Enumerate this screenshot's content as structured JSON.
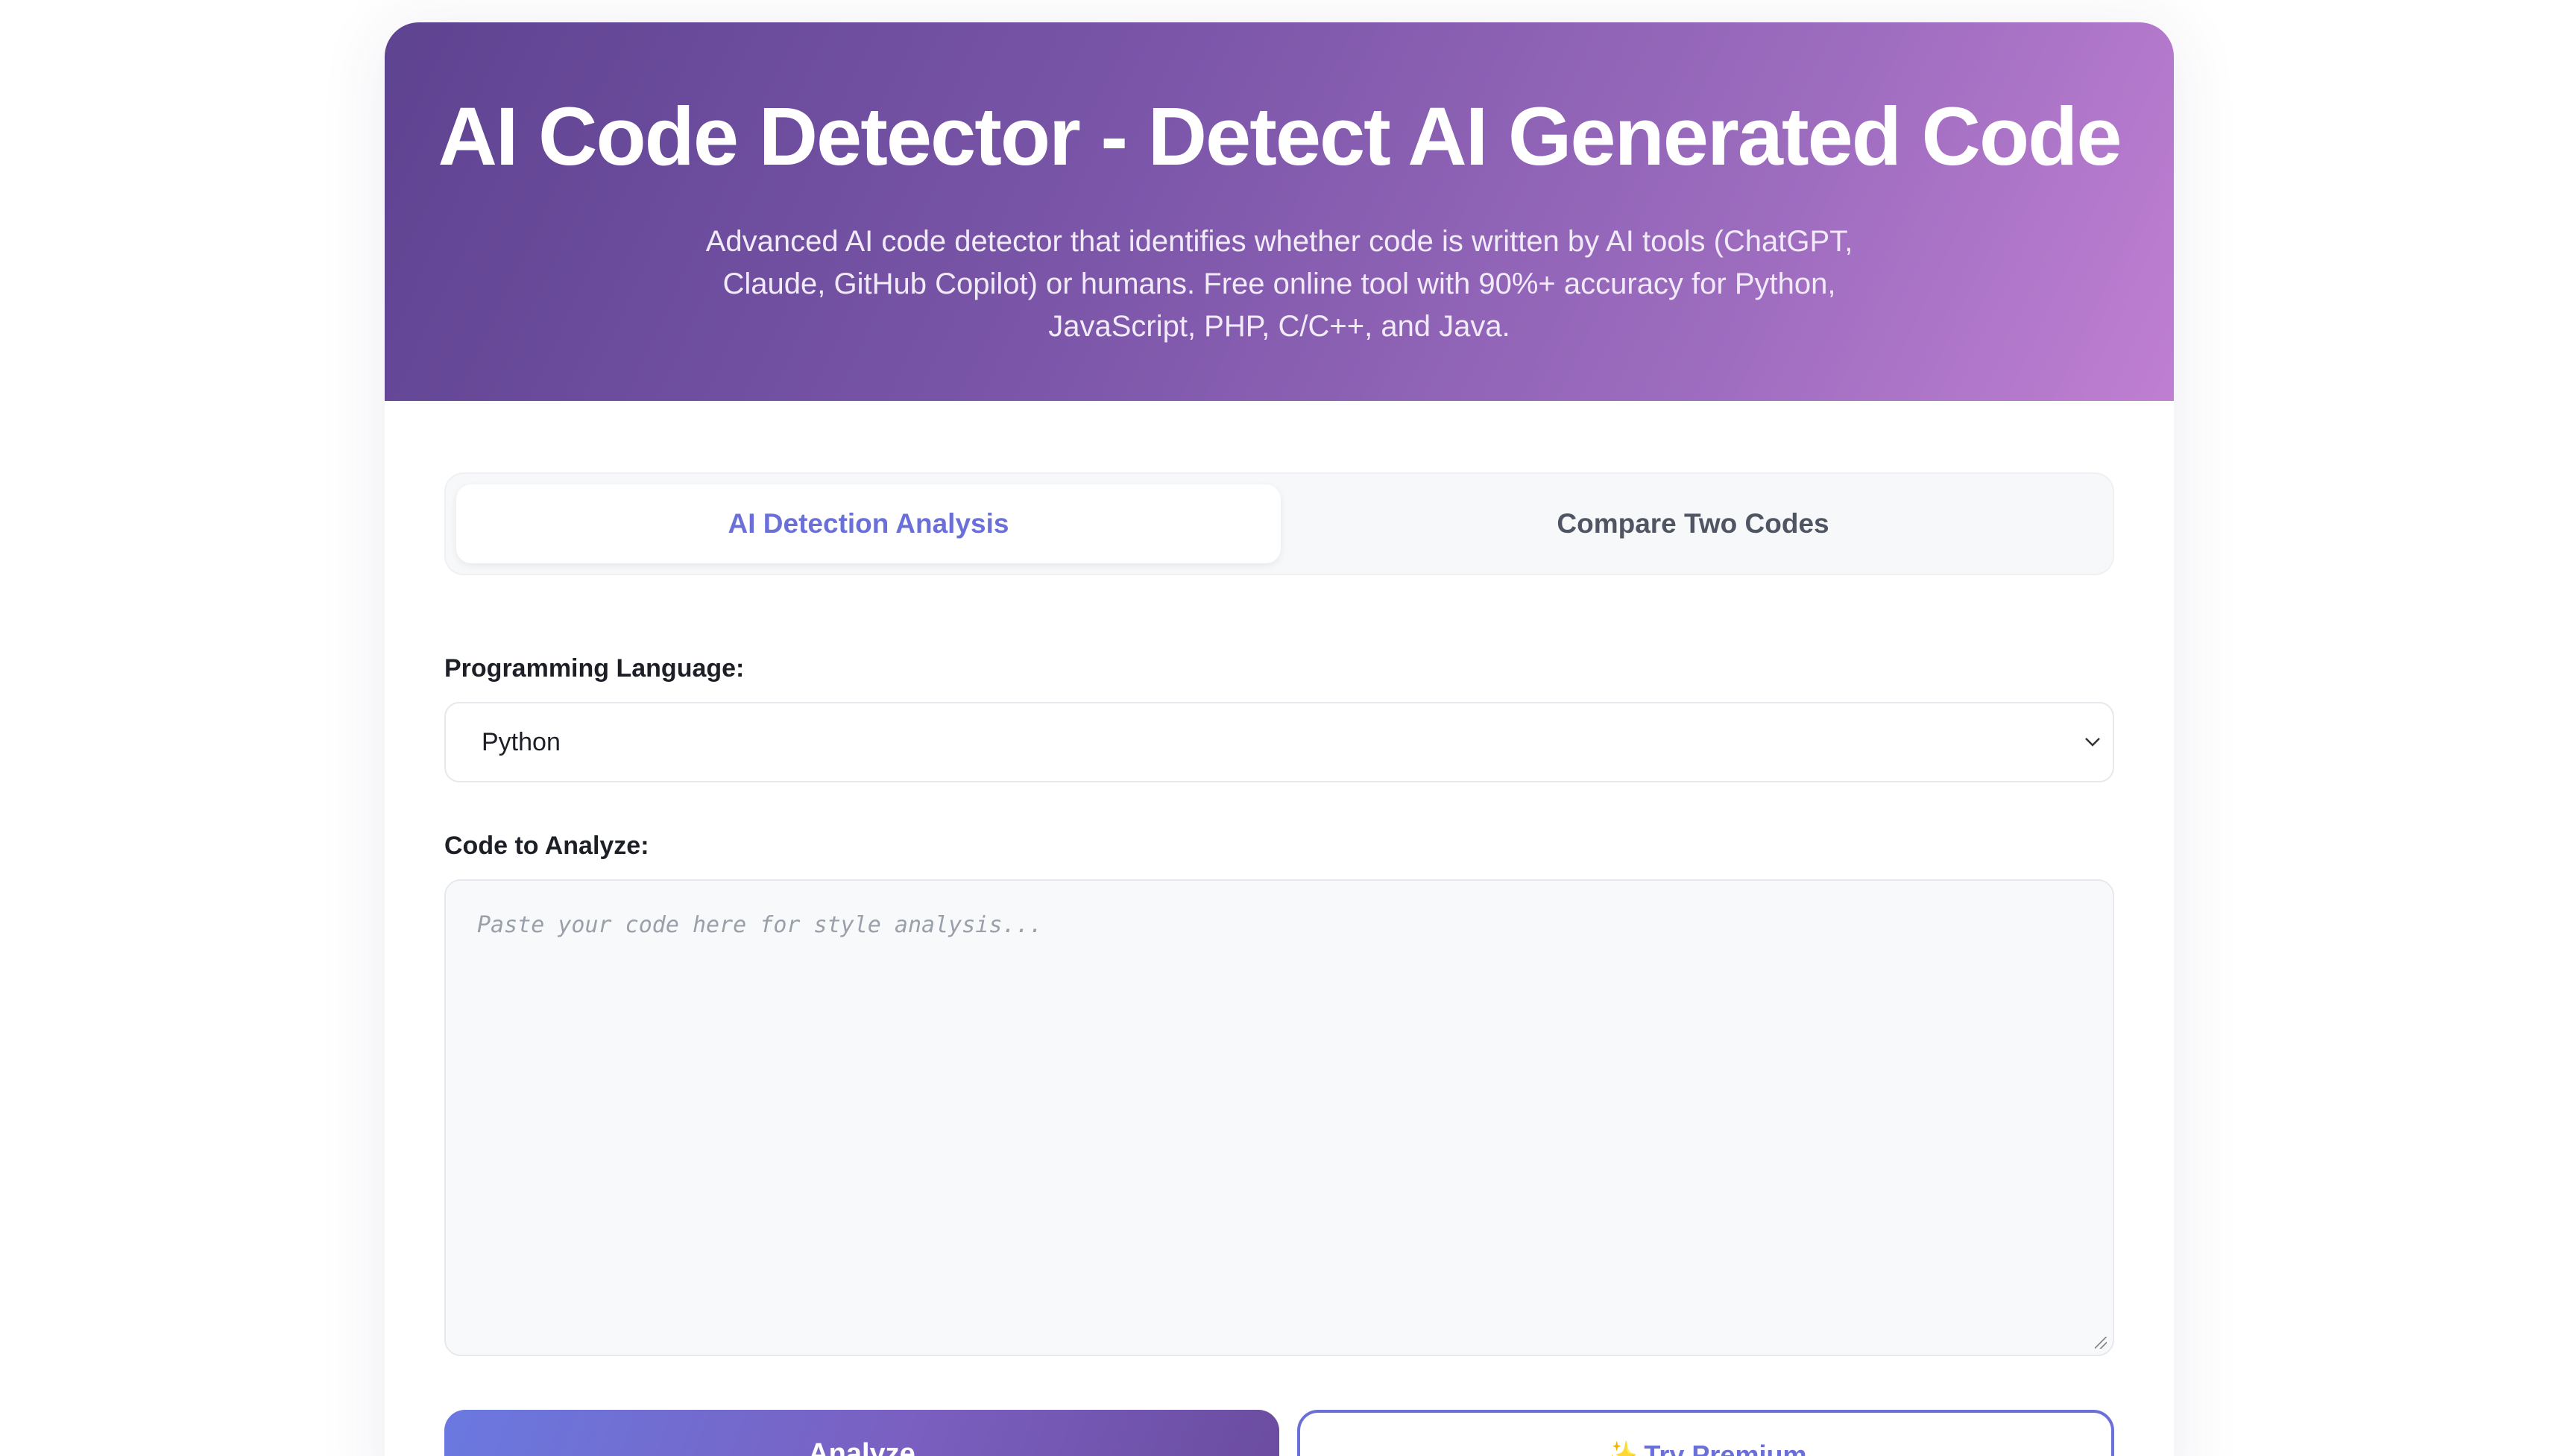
{
  "hero": {
    "title": "AI Code Detector - Detect AI Generated Code",
    "description": "Advanced AI code detector that identifies whether code is written by AI tools (ChatGPT, Claude, GitHub Copilot) or humans. Free online tool with 90%+ accuracy for Python, JavaScript, PHP, C/C++, and Java."
  },
  "tabs": [
    {
      "label": "AI Detection Analysis",
      "active": true
    },
    {
      "label": "Compare Two Codes",
      "active": false
    }
  ],
  "form": {
    "language_label": "Programming Language:",
    "language_value": "Python",
    "code_label": "Code to Analyze:",
    "code_placeholder": "Paste your code here for style analysis...",
    "code_value": ""
  },
  "actions": {
    "analyze_label": "Analyze",
    "premium_icon": "✨",
    "premium_label": "Try Premium"
  },
  "colors": {
    "accent": "#6a70d8",
    "hero_gradient_start": "#5e4391",
    "hero_gradient_end": "#bf7fd2"
  }
}
